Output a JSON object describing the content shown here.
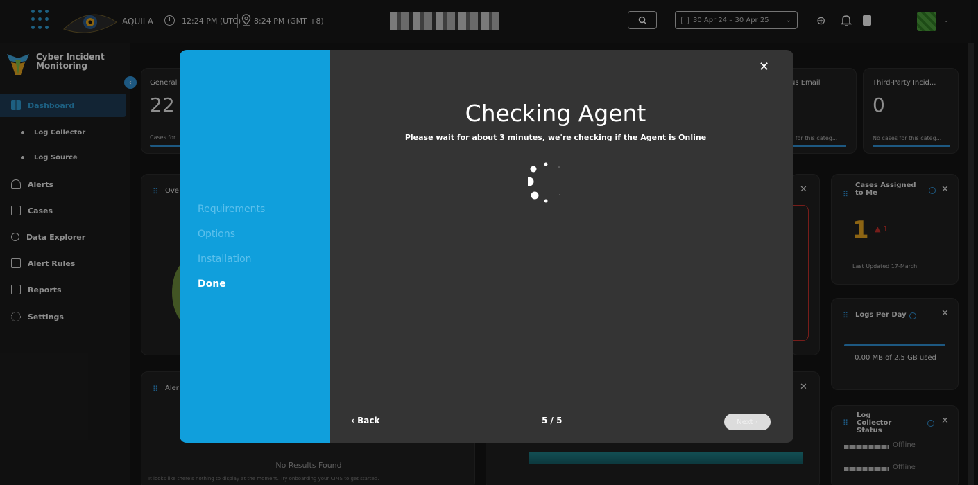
{
  "topbar": {
    "brand": "AQUILA",
    "time_utc": "12:24 PM (UTC)",
    "time_local": "8:24 PM (GMT +8)",
    "date_range": "30 Apr 24 – 30 Apr 25"
  },
  "sidebar": {
    "title": "Cyber Incident Monitoring",
    "items": {
      "dashboard": "Dashboard",
      "log_collector": "Log Collector",
      "log_source": "Log Source",
      "alerts": "Alerts",
      "cases": "Cases",
      "data_explorer": "Data Explorer",
      "alert_rules": "Alert Rules",
      "reports": "Reports",
      "settings": "Settings"
    }
  },
  "dashboard": {
    "general_title": "General",
    "general_value": "22",
    "general_sub": "Cases for",
    "email_title": "us Email",
    "email_sub": "s for this categ...",
    "third_party_title": "Third-Party Incid...",
    "third_party_value": "0",
    "third_party_sub": "No cases for this categ...",
    "overview_title": "Ove",
    "cases_assigned_title": "Cases Assigned to Me",
    "cases_assigned_value": "1",
    "cases_assigned_delta": "▲ 1",
    "cases_assigned_updated": "Last Updated 17-March",
    "logs_per_day_title": "Logs Per Day",
    "logs_per_day_value": "0.00 MB of 2.5 GB used",
    "alerts_title": "Aler",
    "no_results": "No Results Found",
    "no_results_desc": "It looks like there's nothing to display at the moment. Try onboarding your CIMS to get started.",
    "log_collector_status_title": "Log Collector Status",
    "offline_1": "Offline",
    "offline_2": "Offline"
  },
  "modal": {
    "steps": [
      "Requirements",
      "Options",
      "Installation",
      "Done"
    ],
    "current_step": "Done",
    "title": "Checking Agent",
    "description": "Please wait for about 3 minutes, we're checking if the Agent is Online",
    "back": "‹ Back",
    "step_count": "5 / 5",
    "next": "Next ›"
  },
  "colors": {
    "accent": "#109fdc",
    "sidebar_active": "#1d3b55",
    "modal_body": "#343434"
  }
}
